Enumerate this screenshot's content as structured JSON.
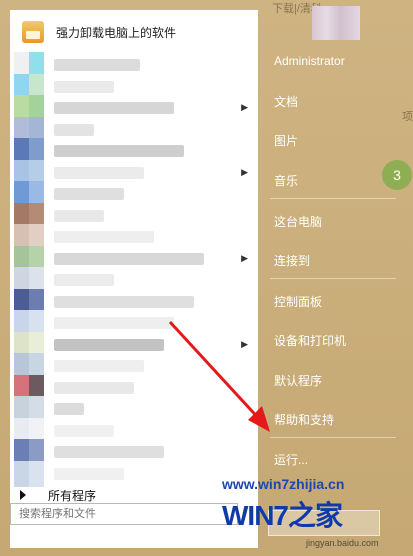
{
  "start_menu": {
    "pinned_top": {
      "label": "强力卸载电脑上的软件",
      "icon": "uninstaller-icon"
    },
    "program_rows": [
      {
        "colors": [
          "#eef0f2",
          "#8fe0ea"
        ],
        "bar": "#d8d8d8",
        "bar_w": 86,
        "arrow": false
      },
      {
        "colors": [
          "#8fd7f1",
          "#c8e6cb"
        ],
        "bar": "#e8e8e8",
        "bar_w": 60,
        "arrow": false
      },
      {
        "colors": [
          "#b9dca3",
          "#a3d39a"
        ],
        "bar": "#d2d2d2",
        "bar_w": 120,
        "arrow": true
      },
      {
        "colors": [
          "#b0bcd8",
          "#a4b6d6"
        ],
        "bar": "#e0e0e0",
        "bar_w": 40,
        "arrow": false
      },
      {
        "colors": [
          "#5b79b6",
          "#7f9ccc"
        ],
        "bar": "#c9c9c9",
        "bar_w": 130,
        "arrow": false
      },
      {
        "colors": [
          "#a9c3e7",
          "#b6cde8"
        ],
        "bar": "#e9e9e9",
        "bar_w": 90,
        "arrow": true
      },
      {
        "colors": [
          "#6f9ad6",
          "#9ab9e5"
        ],
        "bar": "#dbdbdb",
        "bar_w": 70,
        "arrow": false
      },
      {
        "colors": [
          "#a37a66",
          "#b58b76"
        ],
        "bar": "#e6e6e6",
        "bar_w": 50,
        "arrow": false
      },
      {
        "colors": [
          "#d6c0b4",
          "#e1cfc4"
        ],
        "bar": "#ececec",
        "bar_w": 100,
        "arrow": false
      },
      {
        "colors": [
          "#a5c49b",
          "#b6d2ab"
        ],
        "bar": "#d4d4d4",
        "bar_w": 150,
        "arrow": true
      },
      {
        "colors": [
          "#cfd6e2",
          "#dde2ea"
        ],
        "bar": "#eaeaea",
        "bar_w": 60,
        "arrow": false
      },
      {
        "colors": [
          "#4c5c94",
          "#6c7db0"
        ],
        "bar": "#dcdcdc",
        "bar_w": 140,
        "arrow": false
      },
      {
        "colors": [
          "#c9d5ea",
          "#d8e1ef"
        ],
        "bar": "#ececec",
        "bar_w": 120,
        "arrow": false
      },
      {
        "colors": [
          "#dce3c8",
          "#e8eed7"
        ],
        "bar": "#bcbcbc",
        "bar_w": 110,
        "arrow": true
      },
      {
        "colors": [
          "#b7c7d9",
          "#c8d5e3"
        ],
        "bar": "#ededed",
        "bar_w": 90,
        "arrow": false
      },
      {
        "colors": [
          "#d5727c",
          "#6b5a60"
        ],
        "bar": "#e5e5e5",
        "bar_w": 80,
        "arrow": false
      },
      {
        "colors": [
          "#c7d2dc",
          "#d4dde5"
        ],
        "bar": "#d8d8d8",
        "bar_w": 30,
        "arrow": false
      },
      {
        "colors": [
          "#e8ecf1",
          "#f0f2f5"
        ],
        "bar": "#eeeeee",
        "bar_w": 60,
        "arrow": false
      },
      {
        "colors": [
          "#6b7fb4",
          "#8a9cc6"
        ],
        "bar": "#dcdcdc",
        "bar_w": 110,
        "arrow": false
      },
      {
        "colors": [
          "#c9d6e6",
          "#d9e2ee"
        ],
        "bar": "#eeeeee",
        "bar_w": 70,
        "arrow": false
      }
    ],
    "all_programs_label": "所有程序",
    "search_placeholder": "搜索程序和文件"
  },
  "right_column": {
    "user": "Administrator",
    "items": [
      "文档",
      "图片",
      "音乐",
      "这台电脑",
      "连接到",
      "控制面板",
      "设备和打印机",
      "默认程序",
      "帮助和支持",
      "运行..."
    ]
  },
  "background": {
    "text_top": "下载|/清科",
    "text_side": "项",
    "circle_num": "3"
  },
  "watermark": {
    "url": "www.win7zhijia.cn",
    "logo": "WIN7之家",
    "sub": "jingyan.baidu.com"
  },
  "colors": {
    "panel_bg": "#ffffff",
    "frame_bg": "#c9ad7a",
    "arrow_red": "#e41a1a",
    "right_text": "#ffffff"
  }
}
